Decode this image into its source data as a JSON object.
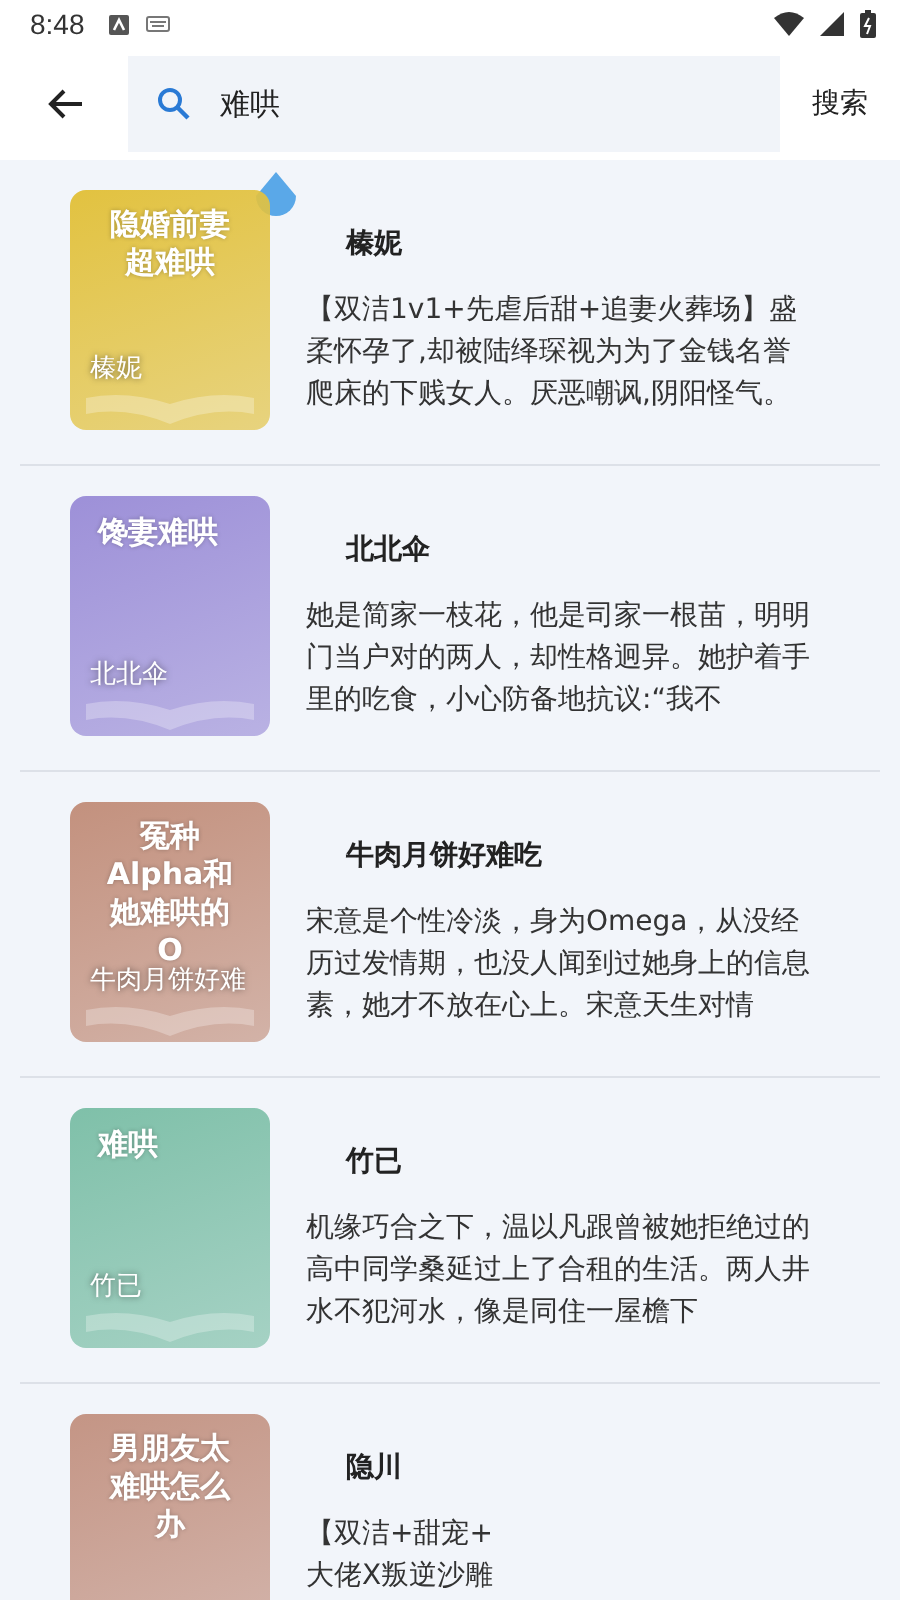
{
  "status_bar": {
    "time": "8:48"
  },
  "search": {
    "value": "难哄",
    "button": "搜索"
  },
  "results": [
    {
      "cover_title": "隐婚前妻超难哄",
      "cover_author": "榛妮",
      "color": "#e2c240",
      "author": "榛妮",
      "description": "【双洁1v1+先虐后甜+追妻火葬场】盛柔怀孕了,却被陆绎琛视为为了金钱名誉爬床的下贱女人。厌恶嘲讽,阴阳怪气。"
    },
    {
      "cover_title": "馋妻难哄",
      "cover_author": "北北伞",
      "color": "#9d90d8",
      "author": "北北伞",
      "description": "她是简家一枝花，他是司家一根苗，明明门当户对的两人，却性格迥异。她护着手里的吃食，小心防备地抗议:“我不"
    },
    {
      "cover_title": "冤种Alpha和她难哄的O",
      "cover_author": "牛肉月饼好难",
      "color": "#c3917e",
      "author": "牛肉月饼好难吃",
      "description": "宋意是个性冷淡，身为Omega，从没经历过发情期，也没人闻到过她身上的信息素，她才不放在心上。宋意天生对情"
    },
    {
      "cover_title": "难哄",
      "cover_author": "竹已",
      "color": "#7fc0a9",
      "author": "竹已",
      "description": "机缘巧合之下，温以凡跟曾被她拒绝过的高中同学桑延过上了合租的生活。两人井水不犯河水，像是同住一屋檐下"
    },
    {
      "cover_title": "男朋友太难哄怎么办",
      "color": "#c49585",
      "author": "隐川",
      "description": "【双洁+甜宠+\n大佬X叛逆沙雕"
    }
  ]
}
